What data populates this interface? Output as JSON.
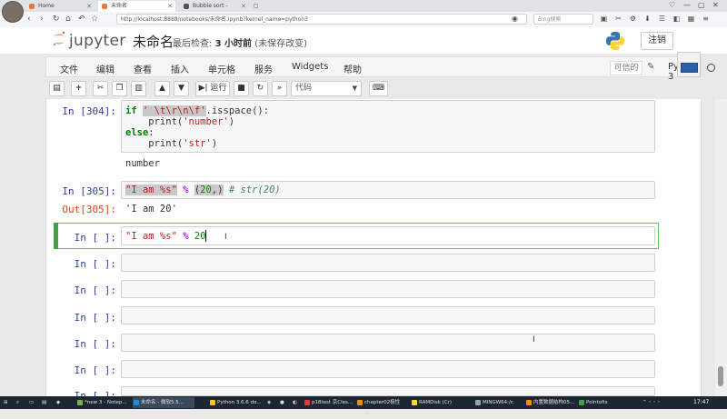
{
  "browser": {
    "tabs": [
      {
        "label": "Home",
        "active": false,
        "color": "#e07b39"
      },
      {
        "label": "未命名",
        "active": true,
        "color": "#e07b39"
      },
      {
        "label": "Bubble sort - Wikipedia",
        "active": false,
        "color": "#555555"
      }
    ],
    "url": "http://localhost:8888/notebooks/未命名.ipynb?kernel_name=python3",
    "search_placeholder": "Bing搜索"
  },
  "header": {
    "logo_text": "jupyter",
    "notebook_name": "未命名",
    "checkpoint_label": "最后检查:",
    "checkpoint_time": "3 小时前",
    "checkpoint_status": "(未保存改变)",
    "logout_label": "注销"
  },
  "menubar": {
    "items": [
      "文件",
      "编辑",
      "查看",
      "插入",
      "单元格",
      "服务",
      "Widgets",
      "帮助"
    ],
    "trusted_label": "可信的",
    "kernel_name": "Python 3"
  },
  "toolbar": {
    "run_label": "运行",
    "cell_type": "代码"
  },
  "cells": [
    {
      "prompt": "In [304]:",
      "lines": [
        "if ' \\t\\r\\n\\f'.isspace():",
        "    print('number')",
        "else:",
        "    print('str')"
      ],
      "output": "number"
    },
    {
      "prompt": "In [305]:",
      "code": "\"I am %s\" % (20,) # str(20)",
      "out_prompt": "Out[305]:",
      "output": "'I am 20'"
    },
    {
      "prompt": "In [ ]:",
      "code": "\"I am %s\" % 20",
      "selected": true
    },
    {
      "prompt": "In [ ]:"
    },
    {
      "prompt": "In [ ]:"
    },
    {
      "prompt": "In [ ]:"
    },
    {
      "prompt": "In [ ]:"
    },
    {
      "prompt": "In [ ]:"
    },
    {
      "prompt": "In [ ]:"
    }
  ],
  "taskbar": {
    "items": [
      "*new 3 - Notep...",
      "未命名 - 微软5.5...",
      "Python 3.6.6 do...",
      "p18test 京Cles...",
      "chapter02极性数...",
      "RAMDisk (Cr)",
      "MINGW64:/c",
      "内置数据结构05...",
      "Pointofix"
    ],
    "clock": "17:47"
  }
}
